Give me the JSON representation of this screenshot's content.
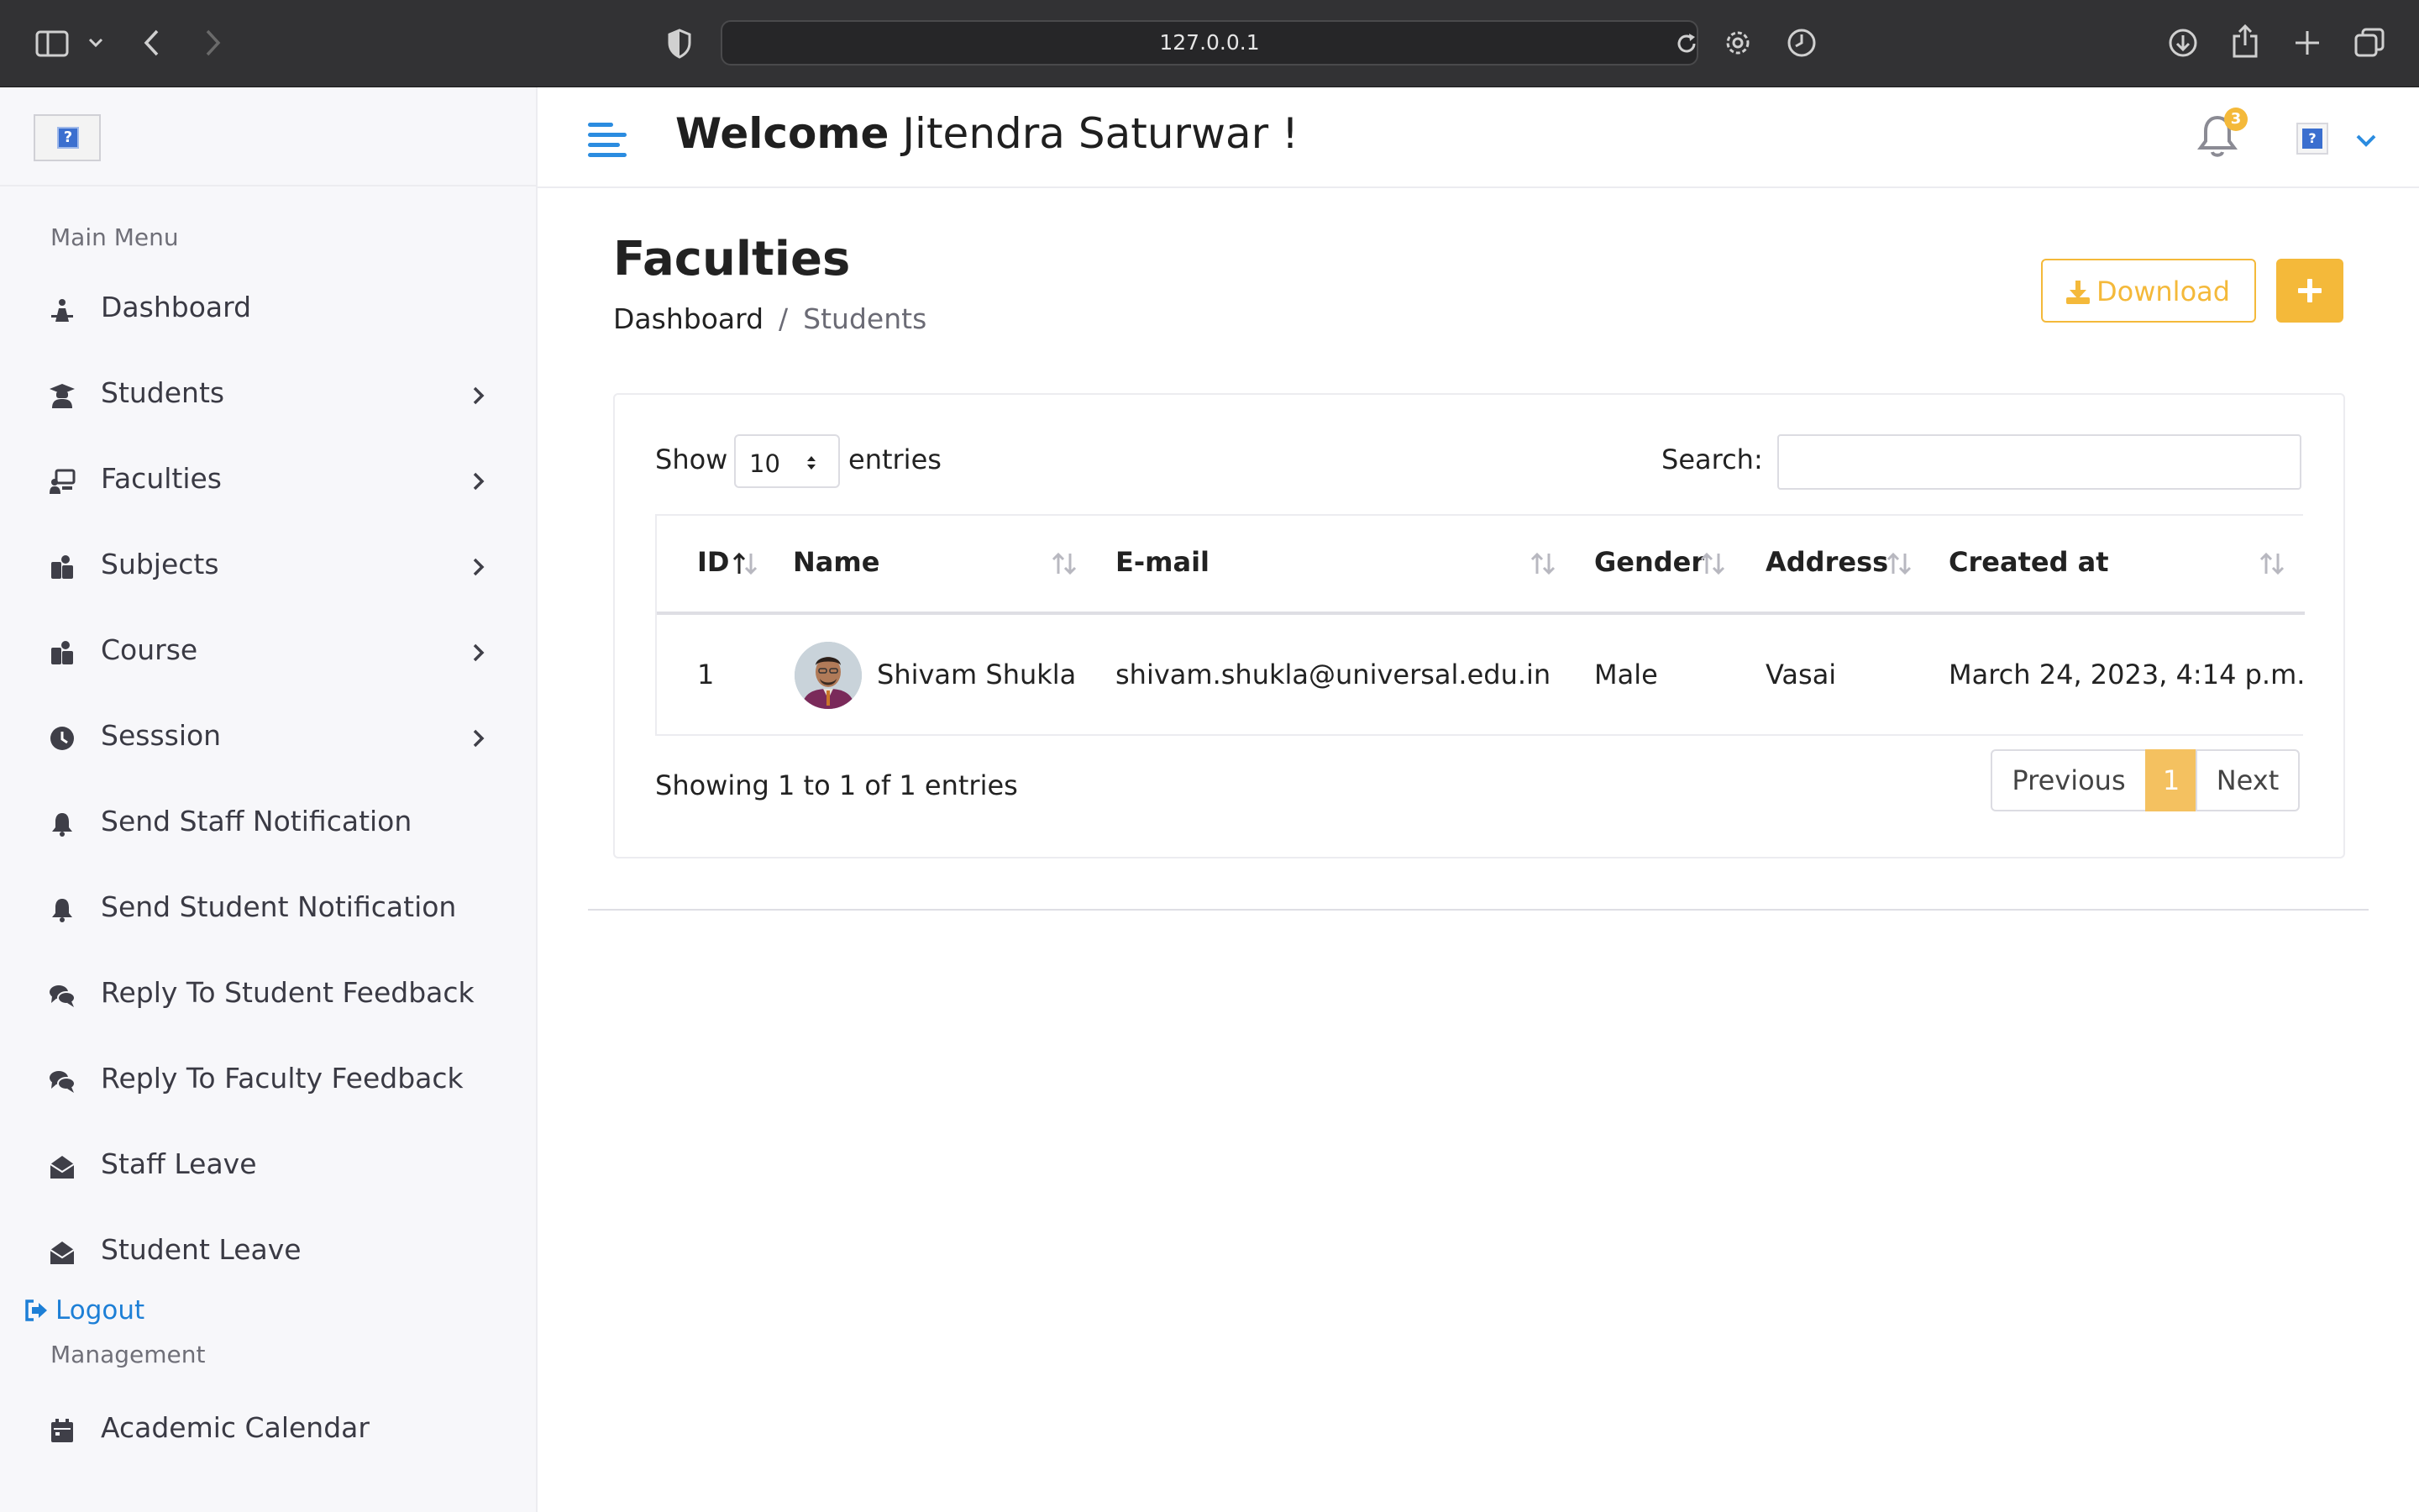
{
  "browser": {
    "url": "127.0.0.1",
    "icons": [
      "sidebar-icon",
      "chevron-down-icon",
      "back-icon",
      "forward-icon",
      "shield-icon",
      "reload-icon",
      "gear-icon",
      "history-icon",
      "download-icon",
      "share-icon",
      "new-tab-icon",
      "tabs-icon"
    ]
  },
  "sidebar": {
    "main_menu_title": "Main Menu",
    "items": [
      {
        "label": "Dashboard",
        "icon": "dashboard-icon",
        "has_submenu": false
      },
      {
        "label": "Students",
        "icon": "graduate-icon",
        "has_submenu": true
      },
      {
        "label": "Faculties",
        "icon": "teacher-icon",
        "has_submenu": true
      },
      {
        "label": "Subjects",
        "icon": "users-icon",
        "has_submenu": true
      },
      {
        "label": "Course",
        "icon": "users-icon",
        "has_submenu": true
      },
      {
        "label": "Sesssion",
        "icon": "clock-icon",
        "has_submenu": true
      },
      {
        "label": "Send Staff Notification",
        "icon": "bell-icon",
        "has_submenu": false
      },
      {
        "label": "Send Student Notification",
        "icon": "bell-icon",
        "has_submenu": false
      },
      {
        "label": "Reply To Student Feedback",
        "icon": "comments-icon",
        "has_submenu": false
      },
      {
        "label": "Reply To Faculty Feedback",
        "icon": "comments-icon",
        "has_submenu": false
      },
      {
        "label": "Staff Leave",
        "icon": "envelope-open-icon",
        "has_submenu": false
      },
      {
        "label": "Student Leave",
        "icon": "envelope-open-icon",
        "has_submenu": false
      }
    ],
    "logout_label": "Logout",
    "management_title": "Management",
    "management_items": [
      {
        "label": "Academic Calendar",
        "icon": "calendar-icon"
      }
    ]
  },
  "topbar": {
    "welcome_bold": "Welcome",
    "welcome_name": " Jitendra Saturwar  !",
    "notification_count": "3"
  },
  "page": {
    "title": "Faculties",
    "breadcrumb_home": "Dashboard",
    "breadcrumb_sep": "/",
    "breadcrumb_current": "Students",
    "download_label": "Download",
    "add_label": "+"
  },
  "table": {
    "show_label": "Show",
    "page_size": "10",
    "entries_label": "entries",
    "search_label": "Search:",
    "search_value": "",
    "columns": [
      "ID",
      "Name",
      "E-mail",
      "Gender",
      "Address",
      "Created at"
    ],
    "rows": [
      {
        "id": "1",
        "name": "Shivam Shukla",
        "email": "shivam.shukla@universal.edu.in",
        "gender": "Male",
        "address": "Vasai",
        "created_at": "March 24, 2023, 4:14 p.m."
      }
    ],
    "info": "Showing 1 to 1 of 1 entries",
    "pagination": {
      "previous": "Previous",
      "current": "1",
      "next": "Next"
    }
  },
  "colors": {
    "accent": "#f4b93a",
    "link": "#1d7fd6",
    "chrome": "#323234"
  }
}
